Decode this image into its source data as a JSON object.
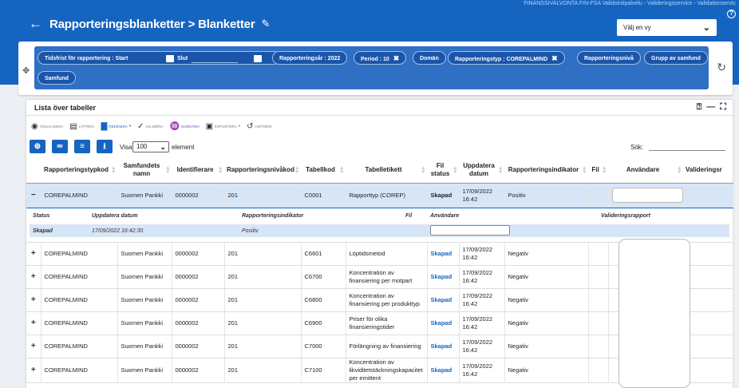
{
  "header": {
    "top_info": "FINANSSIVALVONTA FIN-FSA Validointipalvelu - Valideringsservice - Validationservic",
    "title": "Rapporteringsblanketter > Blanketter",
    "view_select": "Välj en vy",
    "back_icon": "arrow-left-icon",
    "edit_icon": "pencil-icon"
  },
  "filters": {
    "date_start_label": "Tidsfrist för rapportering : Start",
    "date_end_label": "Slut",
    "year": "Rapporteringsår : 2022",
    "period": "Period : 10",
    "domain": "Domän",
    "type": "Rapporteringstyp : COREPALMIND",
    "level": "Rapporteringsnivå",
    "group": "Grupp av samfund",
    "company": "Samfund"
  },
  "card": {
    "title": "Lista över tabeller",
    "toolbar": [
      "VISUALISERA",
      "LYFTERA",
      "REDIGERA",
      "VALIDERA",
      "GODKÄNN",
      "EXPORTERA",
      "HISTORIK"
    ],
    "visa_label": "Visa",
    "visa_value": "100",
    "element_label": "element",
    "sok_label": "Sök:"
  },
  "columns": [
    "Rapporteringstypkod",
    "Samfundets namn",
    "Identifierare",
    "Rapporteringsnivåkod",
    "Tabellkod",
    "Tabelletikett",
    "Fil status",
    "Uppdatera datum",
    "Rapporteringsindikator",
    "Fil",
    "Användare",
    "Valideringsr"
  ],
  "selected_row": {
    "expander": "−",
    "type": "COREPALMIND",
    "company": "Suomen Pankki",
    "id": "0000002",
    "level": "201",
    "code": "C0001",
    "label": "Rapporttyp (COREP)",
    "status": "Skapad",
    "date": "17/09/2022 16:42",
    "indicator": "Positiv"
  },
  "detail": {
    "headers": [
      "Status",
      "Uppdatera datum",
      "Rapporteringsindikator",
      "Fil",
      "Användare",
      "Valideringsrapport"
    ],
    "status": "Skapad",
    "date": "17/09/2022 16:42:30",
    "indicator": "Positiv"
  },
  "rows": [
    {
      "exp": "+",
      "type": "COREPALMIND",
      "company": "Suomen Pankki",
      "id": "0000002",
      "level": "201",
      "code": "C6601",
      "label": "Löptidsmetod",
      "status": "Skapad",
      "date": "17/09/2022 16:42",
      "indicator": "Negativ"
    },
    {
      "exp": "+",
      "type": "COREPALMIND",
      "company": "Suomen Pankki",
      "id": "0000002",
      "level": "201",
      "code": "C6700",
      "label": "Koncentration av finansiering per motpart",
      "status": "Skapad",
      "date": "17/09/2022 16:42",
      "indicator": "Negativ"
    },
    {
      "exp": "+",
      "type": "COREPALMIND",
      "company": "Suomen Pankki",
      "id": "0000002",
      "level": "201",
      "code": "C6800",
      "label": "Koncentration av finansiering per produkttyp",
      "status": "Skapad",
      "date": "17/09/2022 16:42",
      "indicator": "Negativ"
    },
    {
      "exp": "+",
      "type": "COREPALMIND",
      "company": "Suomen Pankki",
      "id": "0000002",
      "level": "201",
      "code": "C6900",
      "label": "Priser för olika finansieringstider",
      "status": "Skapad",
      "date": "17/09/2022 16:42",
      "indicator": "Negativ"
    },
    {
      "exp": "+",
      "type": "COREPALMIND",
      "company": "Suomen Pankki",
      "id": "0000002",
      "level": "201",
      "code": "C7000",
      "label": "Förlängning av finansiering",
      "status": "Skapad",
      "date": "17/09/2022 16:42",
      "indicator": "Negativ"
    },
    {
      "exp": "+",
      "type": "COREPALMIND",
      "company": "Suomen Pankki",
      "id": "0000002",
      "level": "201",
      "code": "C7100",
      "label": "Koncentration av likviditetstäckningskapacitet per emittent",
      "status": "Skapad",
      "date": "17/09/2022 16:42",
      "indicator": "Negativ"
    }
  ]
}
